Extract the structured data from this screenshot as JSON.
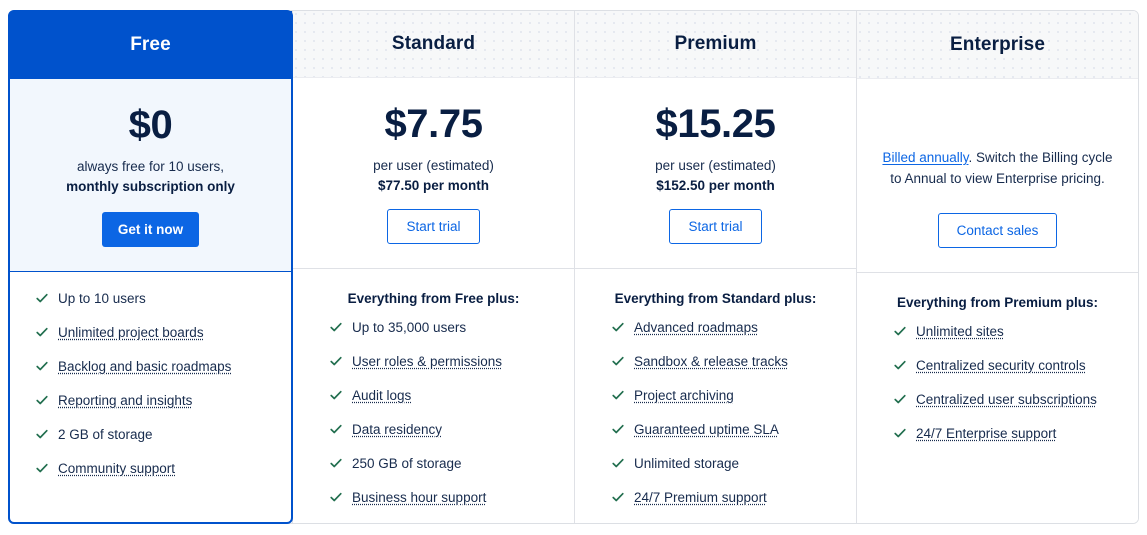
{
  "plans": [
    {
      "id": "free",
      "title": "Free",
      "price": "$0",
      "price_sub_line1": "always free for 10 users,",
      "price_sub_line2": "monthly subscription only",
      "cta_label": "Get it now",
      "cta_style": "primary",
      "features_title": "",
      "features": [
        {
          "label": "Up to 10 users",
          "link": false
        },
        {
          "label": "Unlimited project boards",
          "link": true
        },
        {
          "label": "Backlog and basic roadmaps",
          "link": true
        },
        {
          "label": "Reporting and insights",
          "link": true
        },
        {
          "label": "2 GB of storage",
          "link": false
        },
        {
          "label": "Community support",
          "link": true
        }
      ]
    },
    {
      "id": "standard",
      "title": "Standard",
      "price": "$7.75",
      "price_sub_line1": "per user (estimated)",
      "price_sub_line2": "$77.50 per month",
      "cta_label": "Start trial",
      "cta_style": "outline",
      "features_title": "Everything from Free plus:",
      "features": [
        {
          "label": "Up to 35,000 users",
          "link": false
        },
        {
          "label": "User roles & permissions",
          "link": true
        },
        {
          "label": "Audit logs",
          "link": true
        },
        {
          "label": "Data residency",
          "link": true
        },
        {
          "label": "250 GB of storage",
          "link": false
        },
        {
          "label": "Business hour support",
          "link": true
        }
      ]
    },
    {
      "id": "premium",
      "title": "Premium",
      "price": "$15.25",
      "price_sub_line1": "per user (estimated)",
      "price_sub_line2": "$152.50 per month",
      "cta_label": "Start trial",
      "cta_style": "outline",
      "features_title": "Everything from Standard plus:",
      "features": [
        {
          "label": "Advanced roadmaps",
          "link": true
        },
        {
          "label": "Sandbox & release tracks",
          "link": true
        },
        {
          "label": "Project archiving",
          "link": true
        },
        {
          "label": "Guaranteed uptime SLA",
          "link": true
        },
        {
          "label": "Unlimited storage",
          "link": false
        },
        {
          "label": "24/7 Premium support",
          "link": true
        }
      ]
    },
    {
      "id": "enterprise",
      "title": "Enterprise",
      "note_link": "Billed annually",
      "note_rest": ". Switch the Billing cycle to Annual to view Enterprise pricing.",
      "cta_label": "Contact sales",
      "cta_style": "outline",
      "features_title": "Everything from Premium plus:",
      "features": [
        {
          "label": "Unlimited sites",
          "link": true
        },
        {
          "label": "Centralized security controls",
          "link": true
        },
        {
          "label": "Centralized user subscriptions",
          "link": true
        },
        {
          "label": "24/7 Enterprise support",
          "link": true
        }
      ]
    }
  ],
  "colors": {
    "brand_blue": "#0052cc",
    "link_blue": "#0c66e4",
    "check_green": "#216e4e",
    "text_dark": "#091e42",
    "text_body": "#172b4d",
    "header_grey": "#f7f8f9",
    "free_tint": "#f2f7fd",
    "border_grey": "#dfe1e6"
  },
  "icons": {
    "check": "check-icon"
  }
}
